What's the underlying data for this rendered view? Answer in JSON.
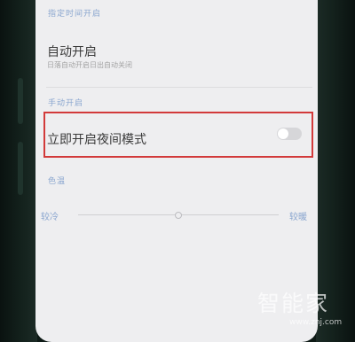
{
  "sections": {
    "scheduled_label": "指定时间开启",
    "manual_label": "手动开启",
    "color_temp_label": "色温"
  },
  "auto_on": {
    "title": "自动开启",
    "subtitle": "日落自动开启日出自动关闭"
  },
  "night_mode": {
    "title": "立即开启夜间模式",
    "enabled": false
  },
  "color_temp_slider": {
    "min_label": "较冷",
    "max_label": "较暖",
    "level": 0.5
  },
  "watermark": {
    "text": "智能家",
    "url": "www.znj.com"
  },
  "colors": {
    "accent_label": "#8aa6cf",
    "highlight_box": "#d23a3a",
    "screen_bg": "#eeeef0"
  }
}
